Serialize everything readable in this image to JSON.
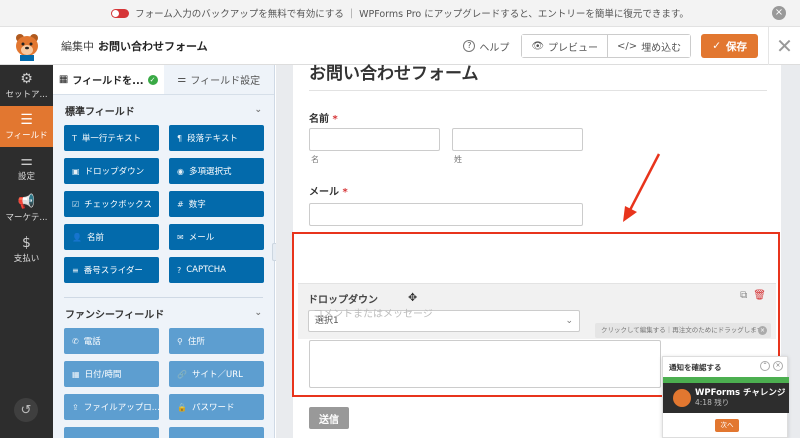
{
  "notice": {
    "text1": "フォーム入力のバックアップを無料で有効にする",
    "text2": "WPForms Pro にアップグレードすると、エントリーを簡単に復元できます。",
    "close": "×"
  },
  "header": {
    "editing_prefix": "編集中",
    "form_name": "お問い合わせフォーム",
    "help": "ヘルプ",
    "preview": "プレビュー",
    "embed": "埋め込む",
    "save": "保存",
    "close": "✕"
  },
  "sidebar": {
    "items": [
      {
        "label": "セットア...",
        "icon": "gear-icon"
      },
      {
        "label": "フィールド",
        "icon": "fields-icon"
      },
      {
        "label": "設定",
        "icon": "sliders-icon"
      },
      {
        "label": "マーケテ...",
        "icon": "megaphone-icon"
      },
      {
        "label": "支払い",
        "icon": "dollar-icon"
      }
    ],
    "active_index": 1
  },
  "panel": {
    "tabs": [
      "フィールドを...",
      "フィールド設定"
    ],
    "standard_title": "標準フィールド",
    "standard_fields": [
      {
        "label": "単一行テキスト",
        "icon": "T"
      },
      {
        "label": "段落テキスト",
        "icon": "¶"
      },
      {
        "label": "ドロップダウン",
        "icon": "▣"
      },
      {
        "label": "多項選択式",
        "icon": "◉"
      },
      {
        "label": "チェックボックス",
        "icon": "☑"
      },
      {
        "label": "数字",
        "icon": "#"
      },
      {
        "label": "名前",
        "icon": "👤"
      },
      {
        "label": "メール",
        "icon": "✉"
      },
      {
        "label": "番号スライダー",
        "icon": "≡"
      },
      {
        "label": "CAPTCHA",
        "icon": "?"
      }
    ],
    "fancy_title": "ファンシーフィールド",
    "fancy_fields": [
      {
        "label": "電話",
        "icon": "✆"
      },
      {
        "label": "住所",
        "icon": "⚲"
      },
      {
        "label": "日付/時間",
        "icon": "▦"
      },
      {
        "label": "サイト／URL",
        "icon": "🔗"
      },
      {
        "label": "ファイルアップロ...",
        "icon": "⇪"
      },
      {
        "label": "パスワード",
        "icon": "🔒"
      }
    ]
  },
  "form": {
    "title": "お問い合わせフォーム",
    "name_label": "名前",
    "name_first_sub": "名",
    "name_last_sub": "姓",
    "email_label": "メール",
    "required_mark": "*",
    "drag": {
      "label": "ドロップダウン",
      "select_placeholder": "コメントまたはメッセージ",
      "select_value": "選択1",
      "hint": "クリックして編集する｜再注文のためにドラッグします"
    },
    "submit": "送信"
  },
  "notification": {
    "title": "通知を確認する",
    "challenge_title": "WPForms チャレンジ",
    "time_left": "4:18 残り",
    "next": "次へ"
  },
  "colors": {
    "accent": "#e27730",
    "field_button": "#036aab",
    "fancy_button": "#5d9ed0",
    "annotation": "#e8341c"
  }
}
